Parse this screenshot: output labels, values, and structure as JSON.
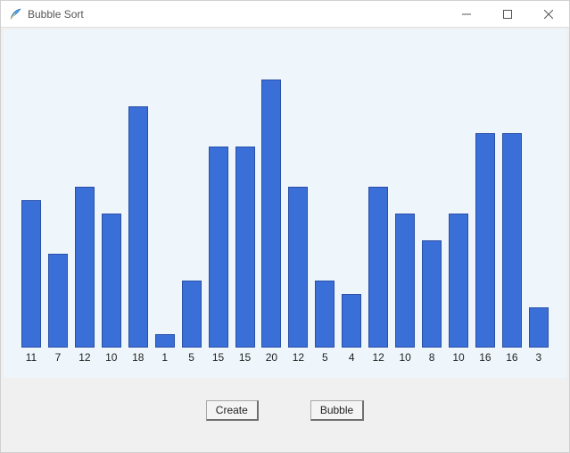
{
  "window": {
    "title": "Bubble Sort",
    "icon_name": "feather-icon"
  },
  "buttons": {
    "create_label": "Create",
    "bubble_label": "Bubble"
  },
  "chart_data": {
    "type": "bar",
    "title": "",
    "xlabel": "",
    "ylabel": "",
    "ylim": [
      0,
      20
    ],
    "categories": [
      "11",
      "7",
      "12",
      "10",
      "18",
      "1",
      "5",
      "15",
      "15",
      "20",
      "12",
      "5",
      "4",
      "12",
      "10",
      "8",
      "10",
      "16",
      "16",
      "3"
    ],
    "values": [
      11,
      7,
      12,
      10,
      18,
      1,
      5,
      15,
      15,
      20,
      12,
      5,
      4,
      12,
      10,
      8,
      10,
      16,
      16,
      3
    ],
    "bar_color": "#3a6fd8"
  }
}
